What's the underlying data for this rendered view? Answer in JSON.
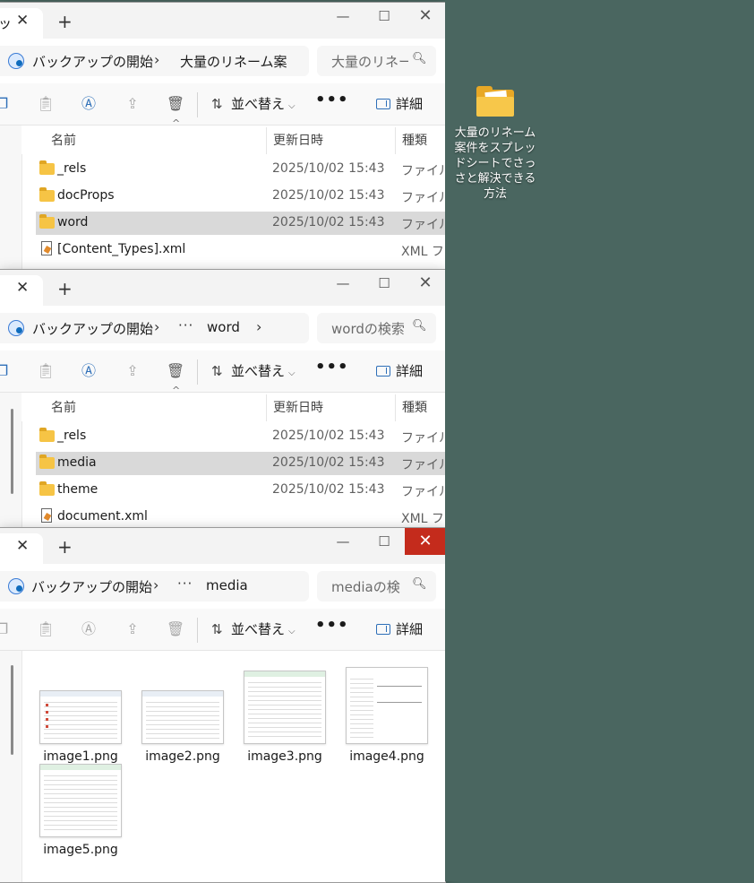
{
  "desktop": {
    "folder_label": "大量のリネーム案件をスプレッドシートでさっさと解決できる方法"
  },
  "toolbar": {
    "sort_label": "並べ替え",
    "more_label": "•••",
    "details_label": "詳細"
  },
  "columns": {
    "name": "名前",
    "date": "更新日時",
    "type": "種類"
  },
  "windows": [
    {
      "tab_text": "ッ",
      "breadcrumb_root": "バックアップの開始",
      "breadcrumb_current": "大量のリネーム案件",
      "search_placeholder": "大量のリネー",
      "files": [
        {
          "name": "_rels",
          "date": "2025/10/02 15:43",
          "type": "ファイル フ",
          "kind": "folder"
        },
        {
          "name": "docProps",
          "date": "2025/10/02 15:43",
          "type": "ファイル フ",
          "kind": "folder"
        },
        {
          "name": "word",
          "date": "2025/10/02 15:43",
          "type": "ファイル フ",
          "kind": "folder"
        },
        {
          "name": "[Content_Types].xml",
          "date": "",
          "type": "XML ファ",
          "kind": "xml"
        }
      ]
    },
    {
      "breadcrumb_root": "バックアップの開始",
      "breadcrumb_ellipsis": "···",
      "breadcrumb_current": "word",
      "search_placeholder": "wordの検索",
      "files": [
        {
          "name": "_rels",
          "date": "2025/10/02 15:43",
          "type": "ファイル フ",
          "kind": "folder"
        },
        {
          "name": "media",
          "date": "2025/10/02 15:43",
          "type": "ファイル フ",
          "kind": "folder"
        },
        {
          "name": "theme",
          "date": "2025/10/02 15:43",
          "type": "ファイル フ",
          "kind": "folder"
        },
        {
          "name": "document.xml",
          "date": "",
          "type": "XML ファ",
          "kind": "xml"
        }
      ]
    },
    {
      "breadcrumb_root": "バックアップの開始",
      "breadcrumb_ellipsis": "···",
      "breadcrumb_current": "media",
      "search_placeholder": "mediaの検",
      "images": [
        {
          "name": "image1.png"
        },
        {
          "name": "image2.png"
        },
        {
          "name": "image3.png"
        },
        {
          "name": "image4.png"
        },
        {
          "name": "image5.png"
        }
      ]
    }
  ]
}
